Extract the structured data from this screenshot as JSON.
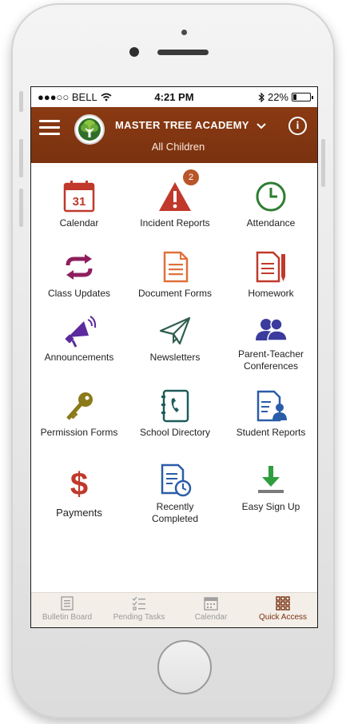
{
  "status_bar": {
    "carrier": "●●●○○ BELL",
    "time": "4:21 PM",
    "battery": "22%",
    "battery_level": 0.22
  },
  "header": {
    "school_name": "MASTER TREE ACADEMY",
    "subtitle": "All Children",
    "chevron": "⌄",
    "info": "i"
  },
  "tiles": [
    {
      "label": "Calendar",
      "icon": "calendar-icon",
      "color": "#c0392b",
      "calendar_day": "31"
    },
    {
      "label": "Incident Reports",
      "icon": "warning-icon",
      "color": "#c0392b",
      "badge": "2"
    },
    {
      "label": "Attendance",
      "icon": "clock-icon",
      "color": "#2e7d32"
    },
    {
      "label": "Class Updates",
      "icon": "sync-icon",
      "color": "#8e1f5e"
    },
    {
      "label": "Document Forms",
      "icon": "document-icon",
      "color": "#e0703a"
    },
    {
      "label": "Homework",
      "icon": "homework-icon",
      "color": "#c0392b"
    },
    {
      "label": "Announcements",
      "icon": "megaphone-icon",
      "color": "#5b2a9e"
    },
    {
      "label": "Newsletters",
      "icon": "paper-plane-icon",
      "color": "#2e5e4e"
    },
    {
      "label": "Parent-Teacher\nConferences",
      "icon": "users-icon",
      "color": "#3b3b9e"
    },
    {
      "label": "Permission Forms",
      "icon": "key-icon",
      "color": "#8a7a1a"
    },
    {
      "label": "School Directory",
      "icon": "phone-book-icon",
      "color": "#1f5c5c"
    },
    {
      "label": "Student Reports",
      "icon": "report-icon",
      "color": "#2a5da8"
    },
    {
      "label": "Payments",
      "icon": "dollar-icon",
      "color": "#c0392b",
      "glyph": "$"
    },
    {
      "label": "Recently\nCompleted",
      "icon": "recent-icon",
      "color": "#2a5da8"
    },
    {
      "label": "Easy Sign Up",
      "icon": "download-icon",
      "color": "#2e9e3e"
    }
  ],
  "tabs": [
    {
      "label": "Bulletin Board",
      "icon": "bulletin-icon",
      "active": false
    },
    {
      "label": "Pending Tasks",
      "icon": "tasks-icon",
      "active": false
    },
    {
      "label": "Calendar",
      "icon": "calendar-tab-icon",
      "active": false
    },
    {
      "label": "Quick Access",
      "icon": "grid-icon",
      "active": true
    }
  ],
  "colors": {
    "header": "#7a3210",
    "badge": "#b8562a",
    "tab_active": "#7a3210"
  }
}
